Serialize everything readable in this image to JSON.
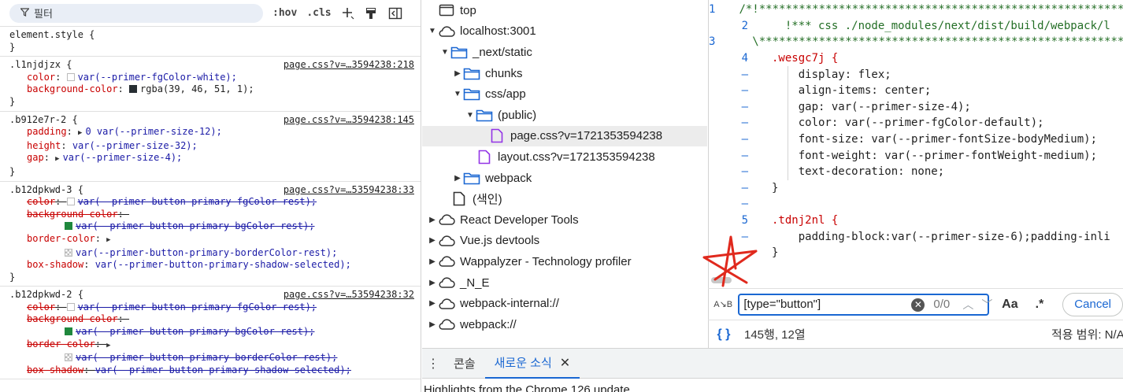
{
  "styles_pane": {
    "filter_placeholder": "필터",
    "hov_label": ":hov",
    "cls_label": ".cls",
    "element_style": "element.style {",
    "rules": [
      {
        "selector": ".l1njdjzx {",
        "source": "page.css?v=…3594238:218",
        "props": [
          {
            "name": "color",
            "swatch": "white",
            "value": "var(--primer-fgColor-white);"
          },
          {
            "name": "background-color",
            "swatch": "dark",
            "value": "rgba(39, 46, 51, 1);"
          }
        ]
      },
      {
        "selector": ".b912e7r-2 {",
        "source": "page.css?v=…3594238:145",
        "props": [
          {
            "name": "padding",
            "tri": true,
            "value": "0 var(--primer-size-12);"
          },
          {
            "name": "height",
            "value": "var(--primer-size-32);"
          },
          {
            "name": "gap",
            "tri": true,
            "value": "var(--primer-size-4);"
          }
        ]
      },
      {
        "selector": ".b12dpkwd-3 {",
        "source": "page.css?v=…53594238:33"
      },
      {
        "selector": ".b12dpkwd-2 {",
        "source": "page.css?v=…53594238:32"
      }
    ],
    "common": {
      "color": "color",
      "fg_rest": "var(--primer-button-primary-fgColor-rest);",
      "bg_name": "background-color",
      "bg_rest": "var(--primer-button-primary-bgColor-rest);",
      "border_name": "border-color",
      "border_rest": "var(--primer-button-primary-borderColor-rest);",
      "shadow_name": "box-shadow",
      "shadow_sel": "var(--primer-button-primary-shadow-selected);"
    }
  },
  "file_tree": {
    "items": [
      {
        "label": "top",
        "icon": "frame-icon",
        "depth": 0,
        "arrow": ""
      },
      {
        "label": "localhost:3001",
        "icon": "cloud-icon",
        "depth": 0,
        "arrow": "down"
      },
      {
        "label": "_next/static",
        "icon": "folder-icon",
        "depth": 1,
        "arrow": "down"
      },
      {
        "label": "chunks",
        "icon": "folder-icon",
        "depth": 2,
        "arrow": "right"
      },
      {
        "label": "css/app",
        "icon": "folder-icon",
        "depth": 2,
        "arrow": "down"
      },
      {
        "label": "(public)",
        "icon": "folder-icon",
        "depth": 3,
        "arrow": "down"
      },
      {
        "label": "page.css?v=1721353594238",
        "icon": "css-file-icon",
        "depth": 4,
        "arrow": "",
        "selected": true
      },
      {
        "label": "layout.css?v=1721353594238",
        "icon": "css-file-icon",
        "depth": 3,
        "arrow": ""
      },
      {
        "label": "webpack",
        "icon": "folder-icon",
        "depth": 2,
        "arrow": "right"
      },
      {
        "label": "(색인)",
        "icon": "file-icon",
        "depth": 1,
        "arrow": ""
      },
      {
        "label": "React Developer Tools",
        "icon": "cloud-icon",
        "depth": 0,
        "arrow": "right"
      },
      {
        "label": "Vue.js devtools",
        "icon": "cloud-icon",
        "depth": 0,
        "arrow": "right"
      },
      {
        "label": "Wappalyzer - Technology profiler",
        "icon": "cloud-icon",
        "depth": 0,
        "arrow": "right"
      },
      {
        "label": "_N_E",
        "icon": "cloud-icon",
        "depth": 0,
        "arrow": "right"
      },
      {
        "label": "webpack-internal://",
        "icon": "cloud-icon",
        "depth": 0,
        "arrow": "right"
      },
      {
        "label": "webpack://",
        "icon": "cloud-icon",
        "depth": 0,
        "arrow": "right"
      }
    ]
  },
  "editor": {
    "lines": [
      {
        "num": "1",
        "text": "/*!**********************************************************************"
      },
      {
        "num": "2",
        "text": "  !*** css ./node_modules/next/dist/build/webpack/l"
      },
      {
        "num": "3",
        "text": "  \\**********************************************************************"
      },
      {
        "num": "4",
        "text": ".wesgc7j {"
      },
      {
        "num": "–",
        "text": "    display: flex;"
      },
      {
        "num": "–",
        "text": "    align-items: center;"
      },
      {
        "num": "–",
        "text": "    gap: var(--primer-size-4);"
      },
      {
        "num": "–",
        "text": "    color: var(--primer-fgColor-default);"
      },
      {
        "num": "–",
        "text": "    font-size: var(--primer-fontSize-bodyMedium);"
      },
      {
        "num": "–",
        "text": "    font-weight: var(--primer-fontWeight-medium);"
      },
      {
        "num": "–",
        "text": "    text-decoration: none;"
      },
      {
        "num": "–",
        "text": "}"
      },
      {
        "num": "–",
        "text": ""
      },
      {
        "num": "5",
        "text": ".tdnj2nl {"
      },
      {
        "num": "–",
        "text": "    padding-block:var(--primer-size-6);padding-inli"
      },
      {
        "num": "–",
        "text": "}"
      }
    ],
    "search": {
      "case_icon": "A↘B",
      "query": "[type=\"button\"]",
      "count": "0/0",
      "aa_label": "Aa",
      "regex_label": ".*",
      "cancel_label": "Cancel"
    },
    "status": {
      "braces": "{ }",
      "cursor": "145행, 12열",
      "coverage": "적용 범위: N/A"
    }
  },
  "drawer": {
    "tabs": [
      {
        "label": "콘솔",
        "active": false
      },
      {
        "label": "새로운 소식",
        "active": true
      }
    ],
    "close": "✕",
    "content": "Highlights from the Chrome 126 update"
  }
}
